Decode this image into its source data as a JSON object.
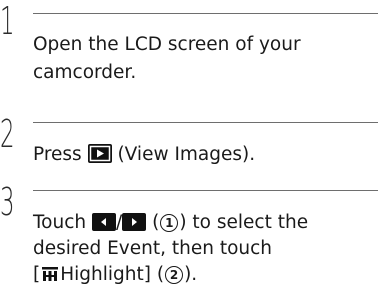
{
  "steps": [
    {
      "number": "1",
      "line1": "Open the LCD screen of your",
      "line2": "camcorder."
    },
    {
      "number": "2",
      "before_icon": "Press ",
      "icon": "view-images-icon",
      "after_icon": " (View Images)."
    },
    {
      "number": "3",
      "l1_before": "Touch ",
      "l1_icon_a": "prev-arrow-icon",
      "l1_slash": "/",
      "l1_icon_b": "next-arrow-icon",
      "l1_paren_open": " (",
      "l1_marker": "1",
      "l1_after": ") to select the",
      "line2": "desired Event, then touch",
      "l3_bracket_open": "[",
      "l3_icon": "highlight-icon",
      "l3_text": "Highlight] (",
      "l3_marker": "2",
      "l3_end": ")."
    }
  ]
}
